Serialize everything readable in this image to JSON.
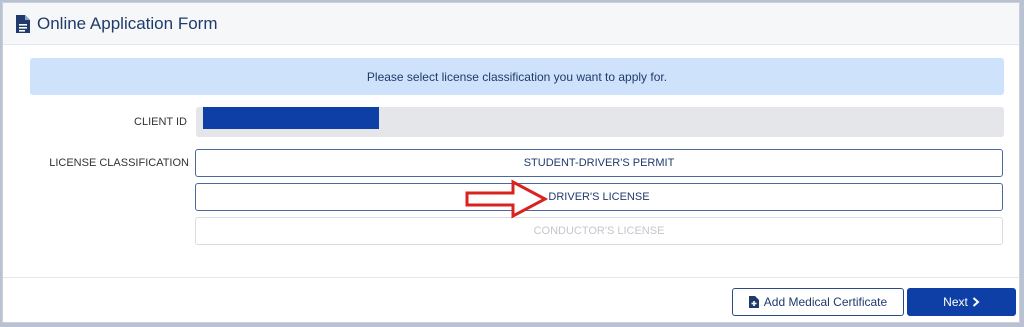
{
  "header": {
    "title": "Online Application Form"
  },
  "banner": {
    "text": "Please select license classification you want to apply for."
  },
  "client": {
    "label": "CLIENT ID",
    "value": ""
  },
  "license": {
    "label": "LICENSE CLASSIFICATION",
    "options": [
      {
        "label": "STUDENT-DRIVER'S PERMIT"
      },
      {
        "label": "DRIVER'S LICENSE"
      },
      {
        "label": "CONDUCTOR'S LICENSE"
      }
    ]
  },
  "footer": {
    "medical_label": "Add Medical Certificate",
    "next_label": "Next"
  },
  "colors": {
    "accent": "#0d3fa6",
    "banner_bg": "#cfe2fb",
    "arrow": "#d9231f"
  },
  "icons": [
    "file-text-icon",
    "file-plus-icon",
    "chevron-right-icon",
    "red-arrow-annotation"
  ]
}
